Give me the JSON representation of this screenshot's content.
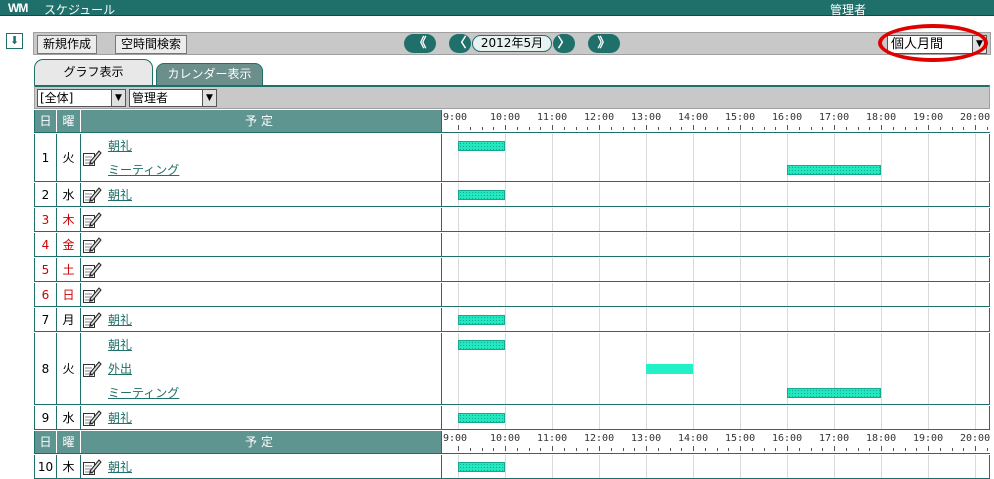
{
  "header": {
    "logo": "WM",
    "app_title": "スケジュール",
    "user_name": "管理者"
  },
  "toolbar": {
    "collapse_icon": "down-arrow-icon",
    "new_label": "新規作成",
    "free_search_label": "空時間検索",
    "prev_year": "《",
    "prev_month": "〈",
    "current_month": "2012年5月",
    "next_month": "〉",
    "next_year": "》",
    "view_select": "個人月間"
  },
  "tabs": {
    "graph": "グラフ表示",
    "calendar": "カレンダー表示"
  },
  "filters": {
    "group": "[全体]",
    "member": "管理者"
  },
  "grid": {
    "col_day": "日",
    "col_weekday": "曜",
    "col_plan": "予定",
    "hours": [
      "9:00",
      "10:00",
      "11:00",
      "12:00",
      "13:00",
      "14:00",
      "15:00",
      "16:00",
      "17:00",
      "18:00",
      "19:00",
      "20:00"
    ],
    "days": [
      {
        "day": "1",
        "weekday": "火",
        "holiday": false,
        "events": [
          {
            "title": "朝礼",
            "start": 9.0,
            "end": 10.0,
            "style": "dotted"
          },
          {
            "title": "ミーティング",
            "start": 16.0,
            "end": 18.0,
            "style": "dotted"
          }
        ]
      },
      {
        "day": "2",
        "weekday": "水",
        "holiday": false,
        "events": [
          {
            "title": "朝礼",
            "start": 9.0,
            "end": 10.0,
            "style": "dotted"
          }
        ]
      },
      {
        "day": "3",
        "weekday": "木",
        "holiday": true,
        "events": []
      },
      {
        "day": "4",
        "weekday": "金",
        "holiday": true,
        "events": []
      },
      {
        "day": "5",
        "weekday": "土",
        "holiday": true,
        "events": []
      },
      {
        "day": "6",
        "weekday": "日",
        "holiday": true,
        "events": []
      },
      {
        "day": "7",
        "weekday": "月",
        "holiday": false,
        "events": [
          {
            "title": "朝礼",
            "start": 9.0,
            "end": 10.0,
            "style": "dotted"
          }
        ]
      },
      {
        "day": "8",
        "weekday": "火",
        "holiday": false,
        "events": [
          {
            "title": "朝礼",
            "start": 9.0,
            "end": 10.0,
            "style": "dotted"
          },
          {
            "title": "外出",
            "start": 13.0,
            "end": 14.0,
            "style": "solid"
          },
          {
            "title": "ミーティング",
            "start": 16.0,
            "end": 18.0,
            "style": "dotted"
          }
        ]
      },
      {
        "day": "9",
        "weekday": "水",
        "holiday": false,
        "events": [
          {
            "title": "朝礼",
            "start": 9.0,
            "end": 10.0,
            "style": "dotted"
          }
        ]
      },
      {
        "day": "10",
        "weekday": "木",
        "holiday": false,
        "events": [
          {
            "title": "朝礼",
            "start": 9.0,
            "end": 10.0,
            "style": "dotted"
          }
        ]
      }
    ]
  }
}
